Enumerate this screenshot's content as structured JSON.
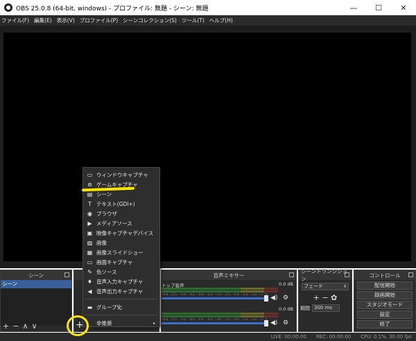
{
  "window": {
    "title": "OBS 25.0.8 (64-bit, windows) - プロファイル: 無題 - シーン: 無題",
    "minimize": "—",
    "maximize": "☐",
    "close": "✕"
  },
  "menu": [
    "ファイル(F)",
    "編集(E)",
    "表示(V)",
    "プロファイル(P)",
    "シーンコレクション(S)",
    "ツール(T)",
    "ヘルプ(H)"
  ],
  "docks": {
    "scenes": {
      "title": "シーン",
      "items": [
        "シーン"
      ],
      "toolbar": [
        "+",
        "−",
        "∧",
        "∨"
      ]
    },
    "sources": {
      "add_button": "+"
    },
    "mixer": {
      "title": "音声ミキサー",
      "channels": [
        {
          "name": "トップ音声",
          "db": "0.0 dB"
        },
        {
          "name": "",
          "db": "0.0 dB"
        }
      ],
      "scale": "-60 -55 -50 -45 -40 -35 -30 -25 -20 -15 -10 -5 0"
    },
    "transitions": {
      "title": "シーントランジション",
      "selected": "フェード",
      "duration_label": "期間",
      "duration": "300 ms",
      "buttons": "+ − ✿"
    },
    "controls": {
      "title": "コントロール",
      "buttons": [
        "配信開始",
        "録画開始",
        "スタジオモード",
        "設定",
        "終了"
      ]
    }
  },
  "status": {
    "live": "LIVE: 00:00:00",
    "rec": "REC: 00:00:00",
    "cpu": "CPU: 0.1%, 30.00 fps"
  },
  "context_menu": {
    "items": [
      {
        "icon": "window-icon",
        "glyph": "▭",
        "label": "ウィンドウキャプチャ"
      },
      {
        "icon": "gamepad-icon",
        "glyph": "⊚",
        "label": "ゲームキャプチャ"
      },
      {
        "icon": "scene-icon",
        "glyph": "▤",
        "label": "シーン"
      },
      {
        "icon": "text-icon",
        "glyph": "T",
        "label": "テキスト(GDI+)"
      },
      {
        "icon": "globe-icon",
        "glyph": "◉",
        "label": "ブラウザ"
      },
      {
        "icon": "play-icon",
        "glyph": "▶",
        "label": "メディアソース"
      },
      {
        "icon": "camera-icon",
        "glyph": "▣",
        "label": "映像キャプチャデバイス"
      },
      {
        "icon": "image-icon",
        "glyph": "▨",
        "label": "画像"
      },
      {
        "icon": "slideshow-icon",
        "glyph": "▦",
        "label": "画像スライドショー"
      },
      {
        "icon": "monitor-icon",
        "glyph": "▭",
        "label": "画面キャプチャ"
      },
      {
        "icon": "brush-icon",
        "glyph": "✎",
        "label": "色ソース"
      },
      {
        "icon": "microphone-icon",
        "glyph": "♦",
        "label": "音声入力キャプチャ"
      },
      {
        "icon": "speaker-icon",
        "glyph": "◀",
        "label": "音声出力キャプチャ"
      }
    ],
    "group": {
      "icon": "folder-icon",
      "glyph": "▬",
      "label": "グループ化"
    },
    "deprecated": {
      "label": "非推奨",
      "arrow": "▸"
    }
  },
  "colors": {
    "highlight": "#ffe600",
    "selected_scene": "#3a5f9a",
    "slider": "#3a6fd0"
  }
}
